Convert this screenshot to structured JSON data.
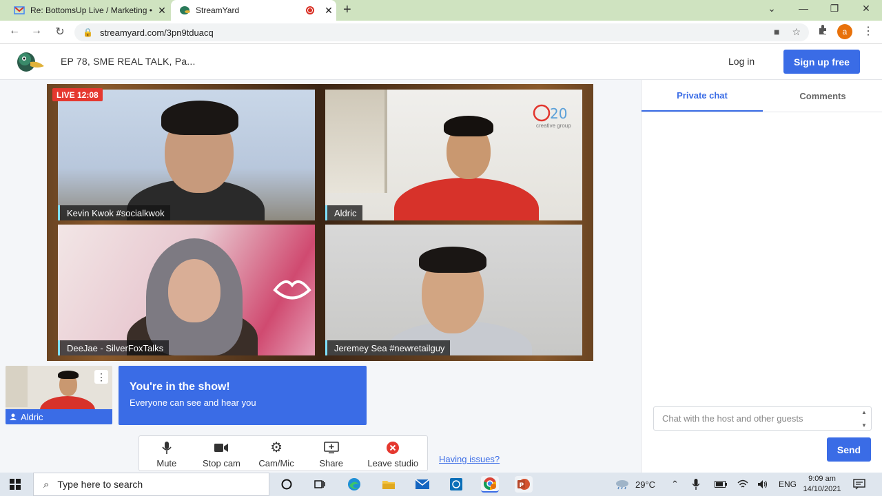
{
  "browser": {
    "tabs": [
      {
        "title": "Re: BottomsUp Live / Marketing •",
        "favicon": "gmail-icon",
        "active": false
      },
      {
        "title": "StreamYard",
        "favicon": "streamyard-icon",
        "active": true
      }
    ],
    "url": "streamyard.com/3pn9tduacq",
    "profile_initial": "a"
  },
  "header": {
    "show_title": "EP 78, SME REAL TALK, Pa...",
    "login_label": "Log in",
    "signup_label": "Sign up free"
  },
  "stage": {
    "live_badge": "LIVE 12:08",
    "participants": [
      {
        "name": "Kevin Kwok #socialkwok"
      },
      {
        "name": "Aldric"
      },
      {
        "name": "DeeJae - SilverFoxTalks"
      },
      {
        "name": "Jeremey Sea #newretailguy"
      }
    ],
    "overlay_logo_text": "creative group"
  },
  "self_preview": {
    "name": "Aldric"
  },
  "status_card": {
    "heading": "You're in the show!",
    "subtext": "Everyone can see and hear you"
  },
  "controls": {
    "mute": "Mute",
    "stop_cam": "Stop cam",
    "cam_mic": "Cam/Mic",
    "share": "Share",
    "leave": "Leave studio",
    "having_issues": "Having issues?"
  },
  "chat": {
    "tab_private": "Private chat",
    "tab_comments": "Comments",
    "placeholder": "Chat with the host and other guests",
    "send_label": "Send"
  },
  "taskbar": {
    "search_placeholder": "Type here to search",
    "weather": "29°C",
    "language": "ENG",
    "time": "9:09 am",
    "date": "14/10/2021"
  },
  "colors": {
    "accent": "#3a6ce6",
    "live": "#e5382f",
    "tab_strip": "#cfe3c0"
  }
}
